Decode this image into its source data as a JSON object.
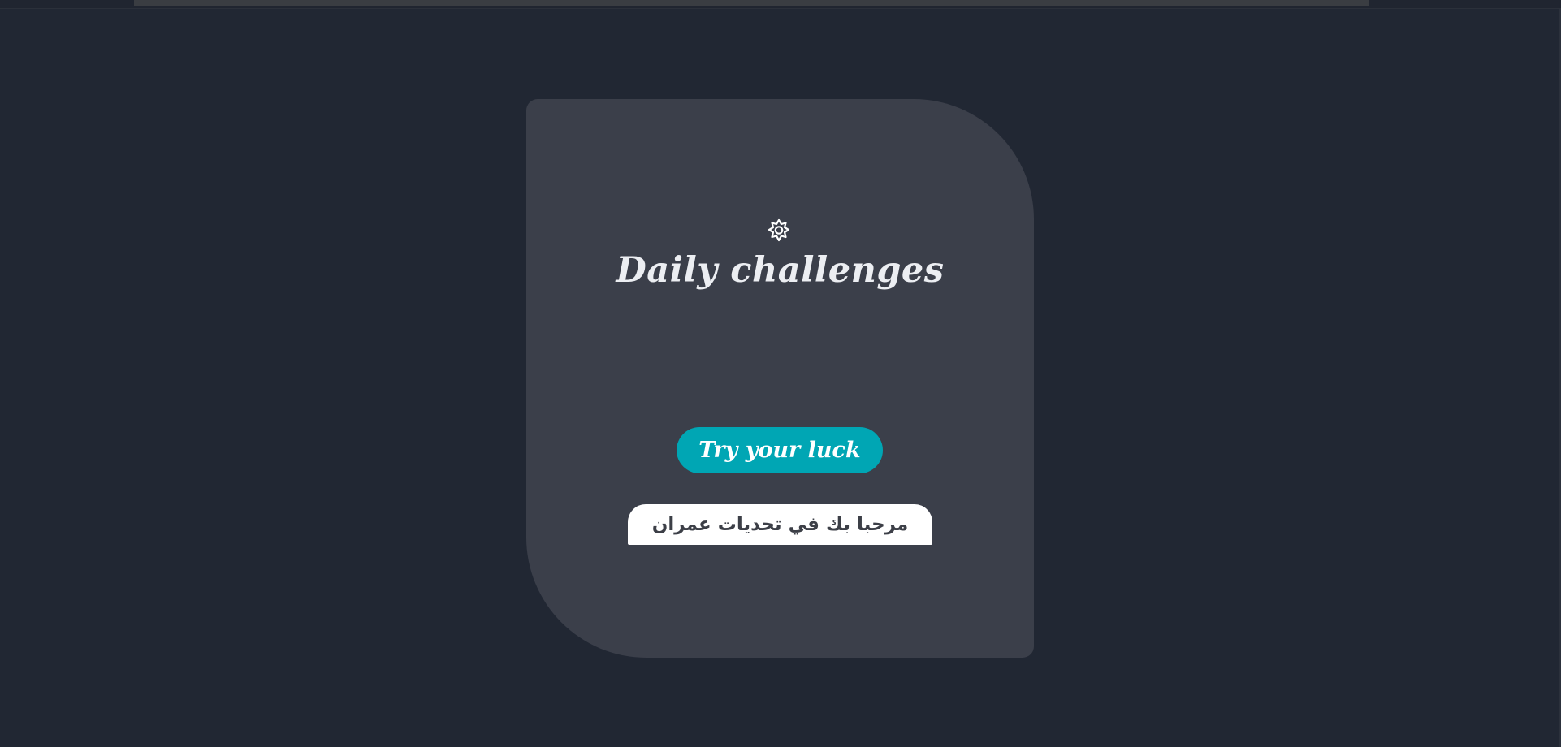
{
  "card": {
    "icon": "gear-icon",
    "title": "Daily challenges",
    "action_label": "Try your luck",
    "welcome_text": "مرحبا بك في تحديات عمران"
  },
  "colors": {
    "background": "#212733",
    "card": "#3b3f4a",
    "accent": "#00a6b4",
    "title_text": "#eceef2"
  }
}
